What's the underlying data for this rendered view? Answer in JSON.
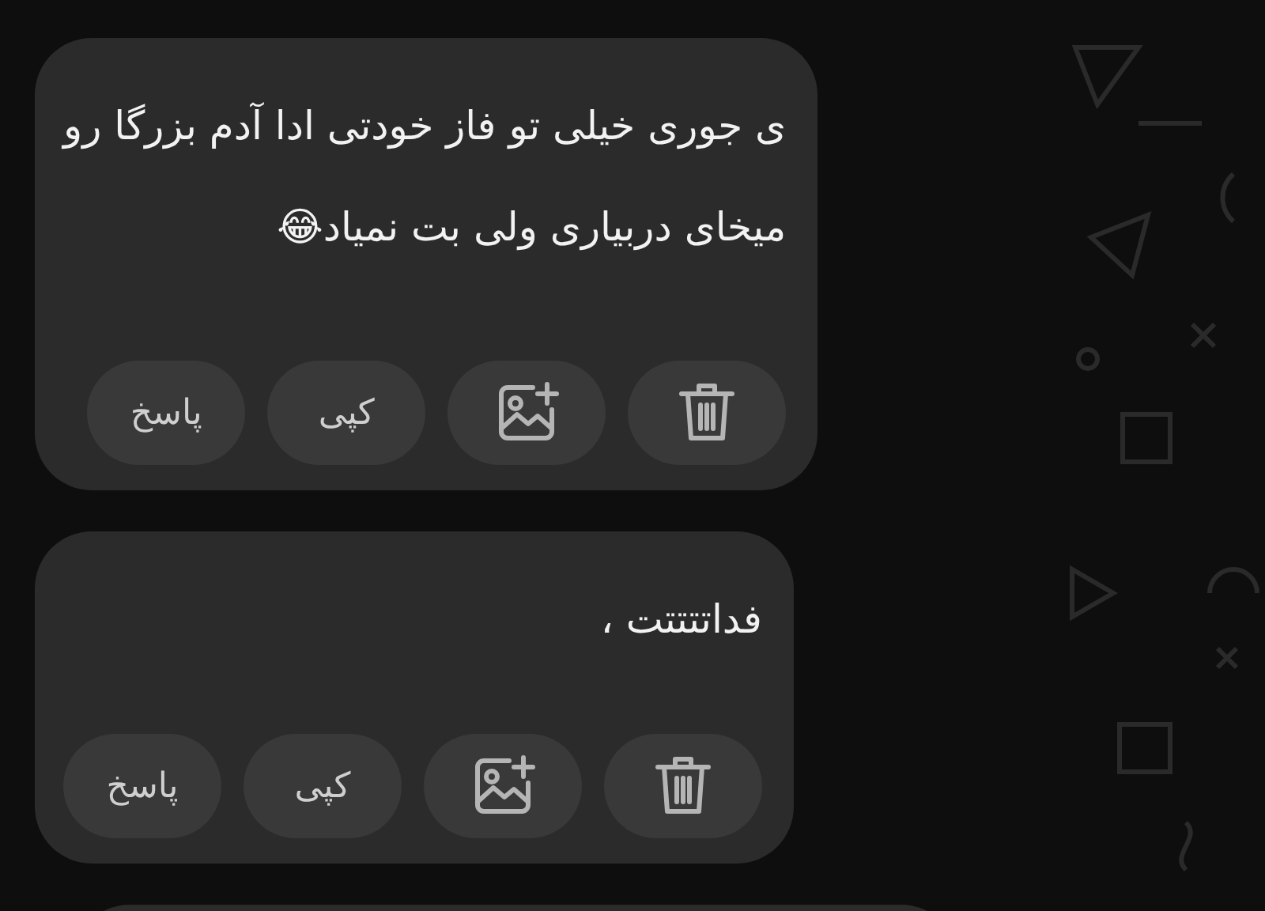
{
  "messages": [
    {
      "lines": [
        "ی جوری خیلی تو فاز خودتی ادا آدم بزرگا رو",
        "میخای دربیاری ولی بت نمیاد😂"
      ],
      "actions": [
        {
          "kind": "delete"
        },
        {
          "kind": "image"
        },
        {
          "kind": "text",
          "label": "کپی"
        },
        {
          "kind": "text",
          "label": "پاسخ"
        }
      ]
    },
    {
      "lines": [
        "فداتتتتت ،"
      ],
      "actions": [
        {
          "kind": "delete"
        },
        {
          "kind": "image"
        },
        {
          "kind": "text",
          "label": "کپی"
        },
        {
          "kind": "text",
          "label": "پاسخ"
        }
      ]
    }
  ]
}
